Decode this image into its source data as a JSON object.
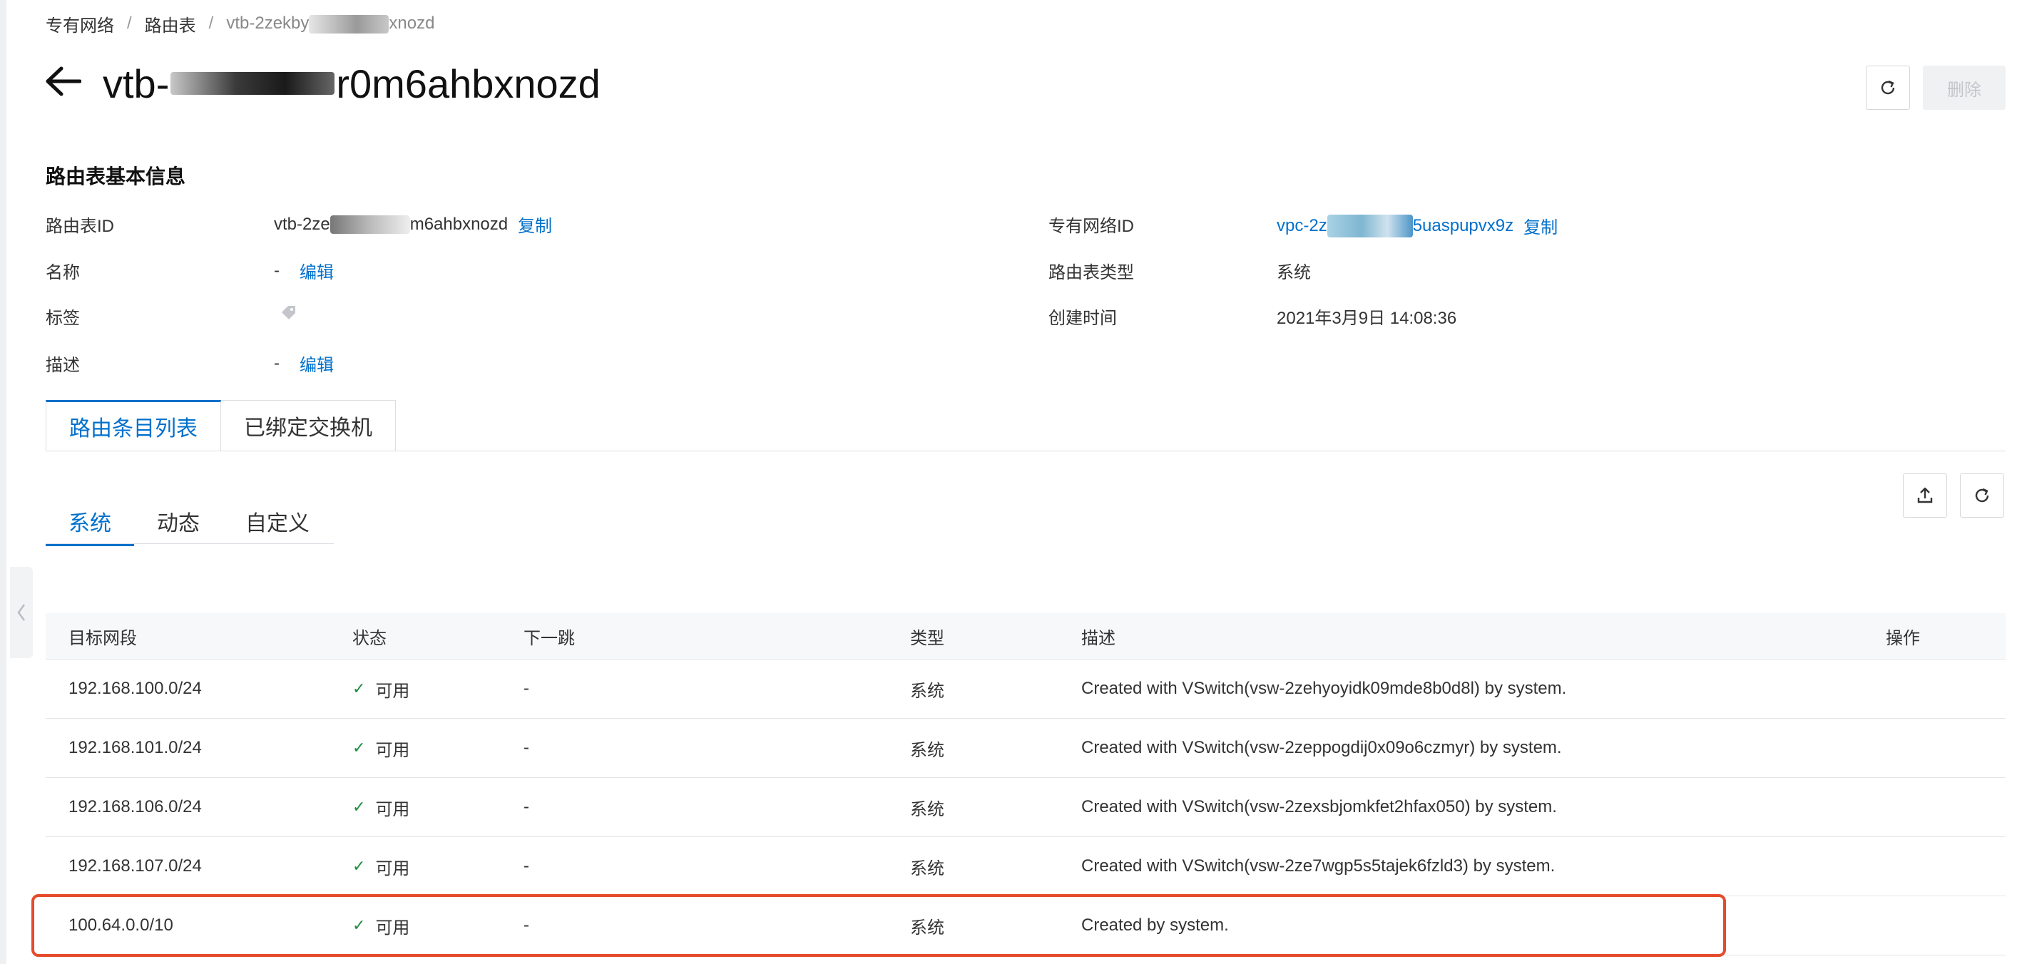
{
  "breadcrumb": {
    "item1": "专有网络",
    "item2": "路由表",
    "current_prefix": "vtb-2zekby",
    "current_suffix": "xnozd"
  },
  "header": {
    "title_prefix": "vtb-",
    "title_suffix": "r0m6ahbxnozd",
    "delete_label": "删除"
  },
  "basic_info": {
    "title": "路由表基本信息",
    "route_table_id": {
      "label": "路由表ID",
      "value_prefix": "vtb-2ze",
      "value_suffix": "m6ahbxnozd",
      "copy": "复制"
    },
    "name": {
      "label": "名称",
      "value": "-",
      "edit": "编辑"
    },
    "tags": {
      "label": "标签"
    },
    "description": {
      "label": "描述",
      "value": "-",
      "edit": "编辑"
    },
    "vpc_id": {
      "label": "专有网络ID",
      "value_prefix": "vpc-2z",
      "value_suffix": "5uaspupvx9z",
      "copy": "复制"
    },
    "route_table_type": {
      "label": "路由表类型",
      "value": "系统"
    },
    "created_time": {
      "label": "创建时间",
      "value": "2021年3月9日 14:08:36"
    }
  },
  "tabs": [
    "路由条目列表",
    "已绑定交换机"
  ],
  "subtabs": [
    "系统",
    "动态",
    "自定义"
  ],
  "table": {
    "headers": [
      "目标网段",
      "状态",
      "下一跳",
      "类型",
      "描述",
      "操作"
    ],
    "rows": [
      {
        "cidr": "192.168.100.0/24",
        "status": "可用",
        "next_hop": "-",
        "type": "系统",
        "desc": "Created with VSwitch(vsw-2zehyoyidk09mde8b0d8l) by system."
      },
      {
        "cidr": "192.168.101.0/24",
        "status": "可用",
        "next_hop": "-",
        "type": "系统",
        "desc": "Created with VSwitch(vsw-2zeppogdij0x09o6czmyr) by system."
      },
      {
        "cidr": "192.168.106.0/24",
        "status": "可用",
        "next_hop": "-",
        "type": "系统",
        "desc": "Created with VSwitch(vsw-2zexsbjomkfet2hfax050) by system."
      },
      {
        "cidr": "192.168.107.0/24",
        "status": "可用",
        "next_hop": "-",
        "type": "系统",
        "desc": "Created with VSwitch(vsw-2ze7wgp5s5tajek6fzld3) by system."
      },
      {
        "cidr": "100.64.0.0/10",
        "status": "可用",
        "next_hop": "-",
        "type": "系统",
        "desc": "Created by system."
      }
    ]
  },
  "colors": {
    "accent": "#0070cc",
    "success": "#1e8e3e",
    "highlight": "#e54b2c"
  }
}
